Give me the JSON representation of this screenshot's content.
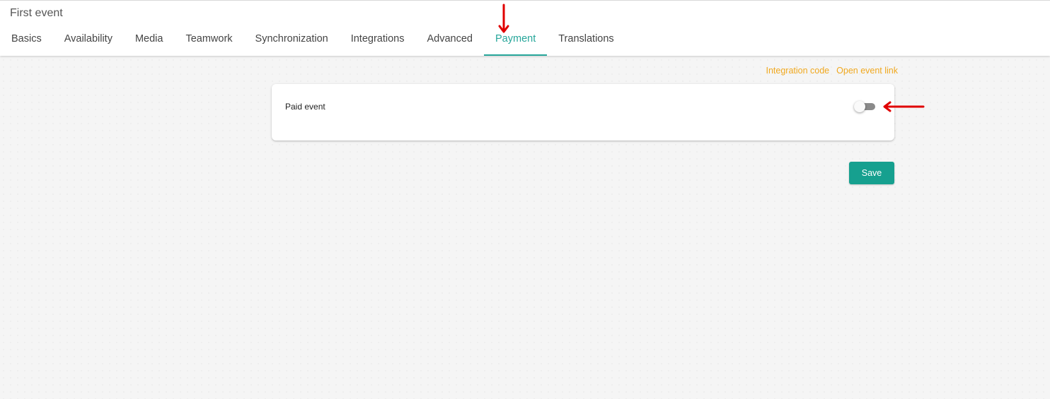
{
  "header": {
    "title": "First event",
    "tabs": [
      {
        "label": "Basics"
      },
      {
        "label": "Availability"
      },
      {
        "label": "Media"
      },
      {
        "label": "Teamwork"
      },
      {
        "label": "Synchronization"
      },
      {
        "label": "Integrations"
      },
      {
        "label": "Advanced"
      },
      {
        "label": "Payment"
      },
      {
        "label": "Translations"
      }
    ],
    "active_tab": "Payment",
    "accent_color": "#26a69a"
  },
  "links": {
    "integration_code": "Integration code",
    "open_event_link": "Open event link",
    "color": "#f0a81e"
  },
  "payment": {
    "paid_event_label": "Paid event",
    "paid_event_enabled": false
  },
  "actions": {
    "save_label": "Save",
    "save_color": "#16a08f"
  },
  "annotations": {
    "arrow_color": "#e00000",
    "arrows": [
      {
        "target": "tab-payment",
        "direction": "down"
      },
      {
        "target": "paid-event-toggle",
        "direction": "left"
      }
    ]
  }
}
